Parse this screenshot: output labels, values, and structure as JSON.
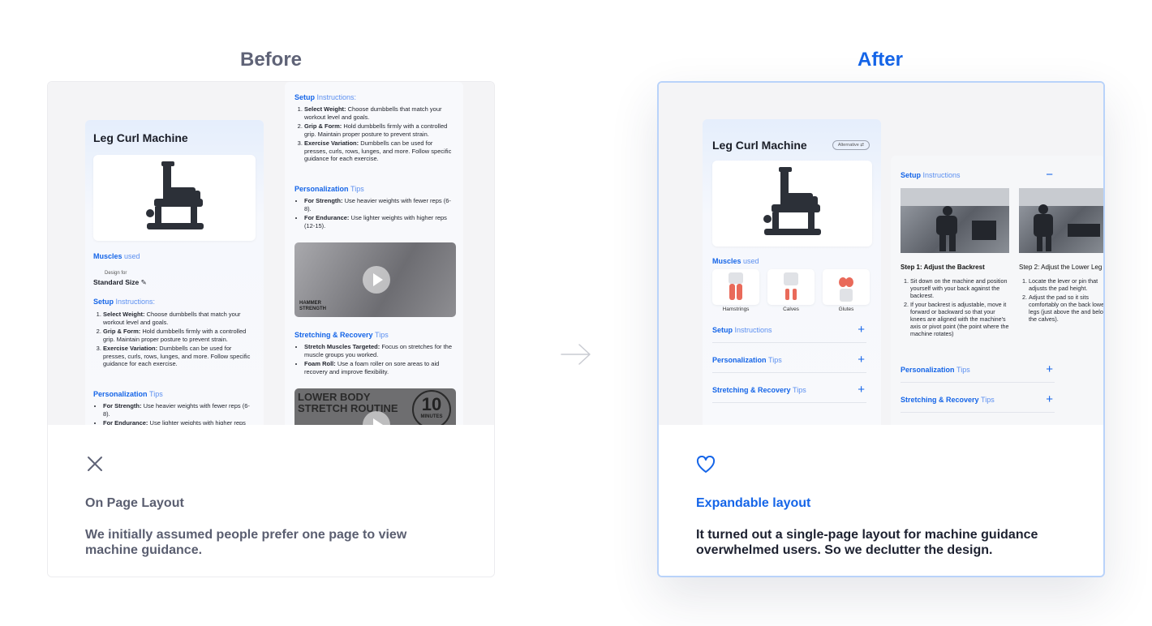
{
  "before": {
    "heading": "Before",
    "mock": {
      "title": "Leg Curl Machine",
      "muscles_section": {
        "strong": "Muscles",
        "light": "used"
      },
      "design_for_label": "Design for",
      "standard_size": "Standard Size",
      "setup_section": {
        "strong": "Setup",
        "light": "Instructions:"
      },
      "setup_items": [
        {
          "bold": "Select Weight:",
          "text": " Choose dumbbells that match your workout level and goals."
        },
        {
          "bold": "Grip & Form:",
          "text": " Hold dumbbells firmly with a controlled grip. Maintain proper posture to prevent strain."
        },
        {
          "bold": "Exercise Variation:",
          "text": " Dumbbells can be used for presses, curls, rows, lunges, and more. Follow specific guidance for each exercise."
        }
      ],
      "personalization_section": {
        "strong": "Personalization",
        "light": "Tips"
      },
      "personalization_items": [
        {
          "bold": "For Strength:",
          "text": " Use heavier weights with fewer reps (6-8)."
        },
        {
          "bold": "For Endurance:",
          "text": " Use lighter weights with higher reps (12-15)."
        }
      ],
      "stretching_section": {
        "strong": "Stretching & Recovery",
        "light": "Tips"
      },
      "stretching_items": [
        {
          "bold": "Stretch Muscles Targeted:",
          "text": " Focus on stretches for the muscle groups you worked."
        },
        {
          "bold": "Foam Roll:",
          "text": " Use a foam roller on sore areas to aid recovery and improve flexibility."
        }
      ],
      "video2_text": "LOWER BODY STRETCH ROUTINE",
      "video2_number": "10",
      "video2_unit": "MINUTES",
      "video1_brand": "HAMMER STRENGTH"
    },
    "caption_title": "On Page Layout",
    "caption_body": "We initially assumed people prefer one page to view machine guidance."
  },
  "after": {
    "heading": "After",
    "mock": {
      "title": "Leg Curl Machine",
      "alternative_label": "Alternative",
      "muscles_section": {
        "strong": "Muscles",
        "light": "used"
      },
      "muscles": [
        "Hamstrings",
        "Calves",
        "Glutes"
      ],
      "setup_section": {
        "strong": "Setup",
        "light": "Instructions"
      },
      "personalization_section": {
        "strong": "Personalization",
        "light": "Tips"
      },
      "stretching_section": {
        "strong": "Stretching & Recovery",
        "light": "Tips"
      },
      "step1_title": "Step 1: Adjust the Backrest",
      "step1_items": [
        "Sit down on the machine and position yourself with your back against the backrest.",
        "If your backrest is adjustable, move it forward or backward so that your knees are aligned with the machine's axis or pivot point (the point where the machine rotates)"
      ],
      "step2_title": "Step 2: Adjust the Lower Leg",
      "step2_items": [
        "Locate the lever or pin that adjusts the pad height.",
        "Adjust the pad so it sits comfortably on the back lower legs (just above the and below the calves)."
      ]
    },
    "caption_title": "Expandable layout",
    "caption_body": "It turned out a single-page layout for machine guidance overwhelmed users. So we declutter the design."
  },
  "colors": {
    "accent": "#1565e8",
    "muted": "#5f6377",
    "panel": "#f4f4f6"
  },
  "icons": {
    "before": "close-icon",
    "after": "heart-icon",
    "transition": "arrow-right-icon"
  }
}
